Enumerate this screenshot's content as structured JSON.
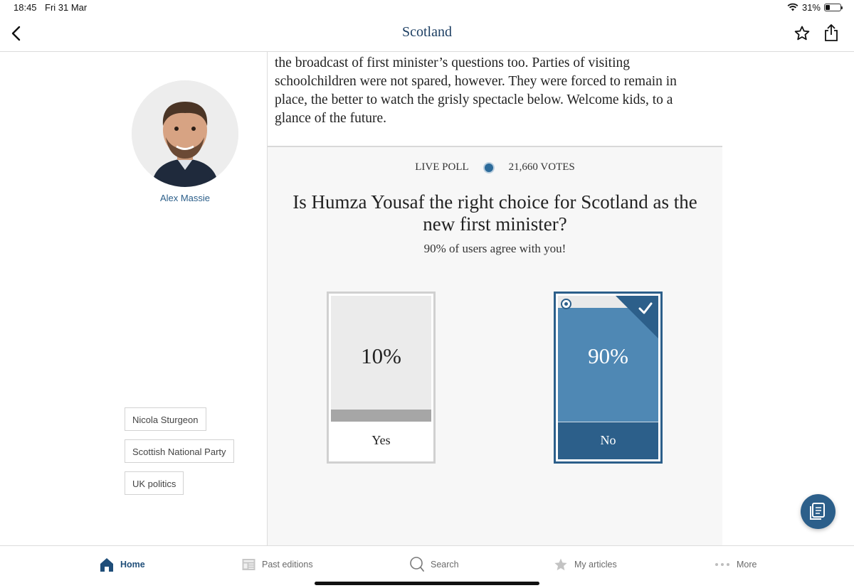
{
  "status_bar": {
    "time": "18:45",
    "date": "Fri 31 Mar",
    "battery": "31%",
    "battery_level": 0.31
  },
  "nav": {
    "title": "Scotland",
    "back_icon": "chevron-left-icon",
    "star_icon": "star-outline-icon",
    "share_icon": "share-icon"
  },
  "author": {
    "name": "Alex Massie"
  },
  "tags": [
    "Nicola Sturgeon",
    "Scottish National Party",
    "UK politics"
  ],
  "article": {
    "lines": [
      "the broadcast of first minister’s questions too. Parties of visiting",
      "schoolchildren were not spared, however. They were forced to remain in",
      "place, the better to watch the grisly spectacle below. Welcome kids, to a",
      "glance of the future."
    ]
  },
  "poll": {
    "label": "LIVE POLL",
    "votes": "21,660 VOTES",
    "question": "Is Humza Yousaf the right choice for Scotland as the new first minister?",
    "agree_text": "90% of users agree with you!",
    "options": [
      {
        "label": "Yes",
        "percent_text": "10%",
        "percent": 10,
        "selected": false
      },
      {
        "label": "No",
        "percent_text": "90%",
        "percent": 90,
        "selected": true
      }
    ]
  },
  "tabbar": {
    "items": [
      {
        "label": "Home",
        "icon": "home-icon",
        "active": true
      },
      {
        "label": "Past editions",
        "icon": "newspaper-icon",
        "active": false
      },
      {
        "label": "Search",
        "icon": "search-icon",
        "active": false
      },
      {
        "label": "My articles",
        "icon": "star-icon",
        "active": false
      },
      {
        "label": "More",
        "icon": "more-dots-icon",
        "active": false
      }
    ]
  },
  "colors": {
    "brand": "#2c5f8a",
    "poll_fill": "#4f88b4",
    "nav_title": "#1d3f63"
  }
}
